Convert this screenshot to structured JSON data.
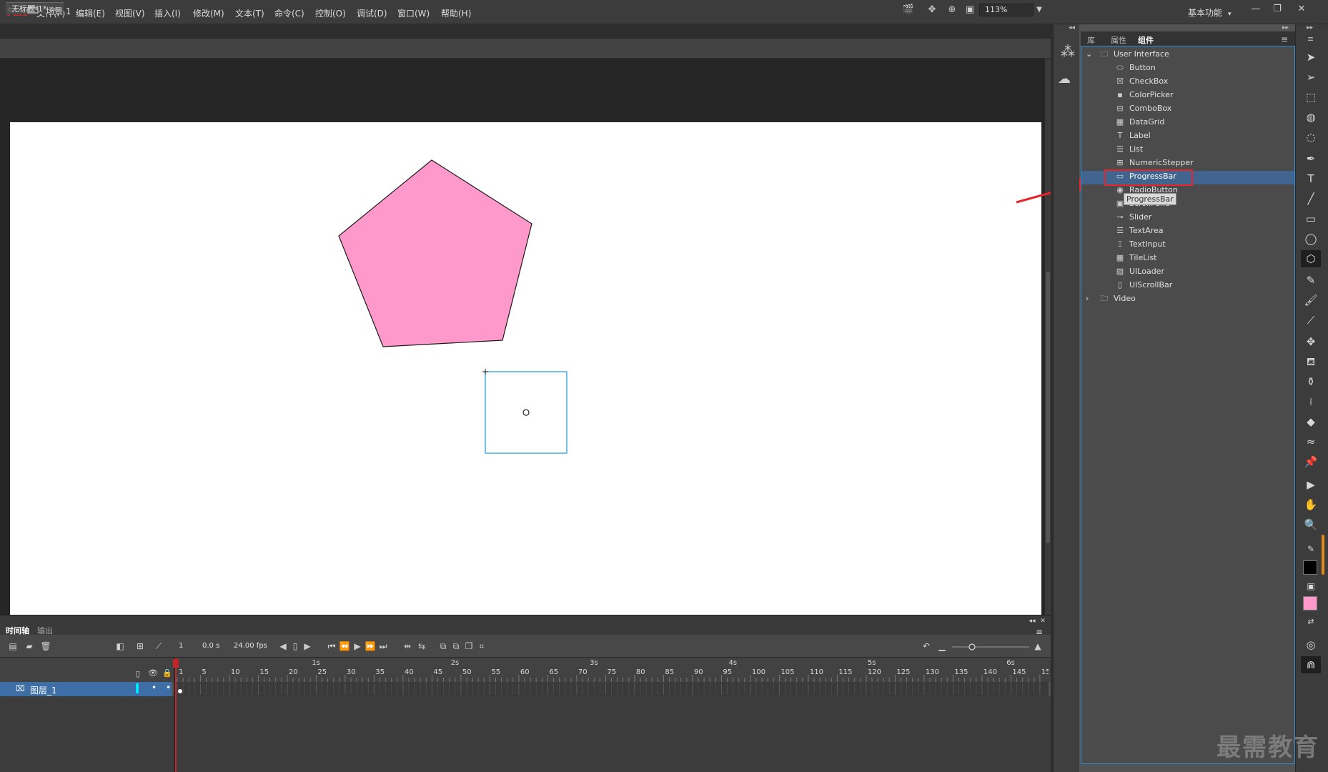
{
  "app": {
    "logo": "An",
    "workspace": "基本功能",
    "workspace_caret": "▾"
  },
  "window_controls": {
    "minimize": "—",
    "restore": "❐",
    "close": "✕"
  },
  "menu": [
    "文件(F)",
    "编辑(E)",
    "视图(V)",
    "插入(I)",
    "修改(M)",
    "文本(T)",
    "命令(C)",
    "控制(O)",
    "调试(D)",
    "窗口(W)",
    "帮助(H)"
  ],
  "document": {
    "tab_title": "无标题-1*",
    "close": "×"
  },
  "editbar": {
    "back": "⇦",
    "scene": "场景 1",
    "zoom": "113%"
  },
  "timeline": {
    "tabs": [
      "时间轴",
      "输出"
    ],
    "current_frame": "1",
    "time": "0.0 s",
    "fps": "24.00 fps",
    "seconds": [
      "1s",
      "2s",
      "3s",
      "4s",
      "5s",
      "6s"
    ],
    "frame_ticks": [
      "1",
      "5",
      "10",
      "15",
      "20",
      "25",
      "30",
      "35",
      "40",
      "45",
      "50",
      "55",
      "60",
      "65",
      "70",
      "75",
      "80",
      "85",
      "90",
      "95",
      "100",
      "105",
      "110",
      "115",
      "120",
      "125",
      "130",
      "135",
      "140",
      "145",
      "15"
    ],
    "layer_name": "图层_1"
  },
  "panel": {
    "tabs": [
      "库",
      "属性",
      "组件"
    ],
    "active_tab": "组件",
    "tree": {
      "ui_folder": "User Interface",
      "components": [
        "Button",
        "CheckBox",
        "ColorPicker",
        "ComboBox",
        "DataGrid",
        "Label",
        "List",
        "NumericStepper",
        "ProgressBar",
        "RadioButton",
        "ScrollPane",
        "Slider",
        "TextArea",
        "TextInput",
        "TileList",
        "UILoader",
        "UIScrollBar"
      ],
      "video_folder": "Video"
    },
    "selected": "ProgressBar",
    "tooltip": "ProgressBar"
  },
  "stage": {
    "pentagon_fill": "#ff99cc",
    "selection_color": "#3ba7e0"
  },
  "colors": {
    "stroke": "#000000",
    "fill": "#ff99cc",
    "highlight": "#e8242b"
  },
  "watermark": "最需教育"
}
